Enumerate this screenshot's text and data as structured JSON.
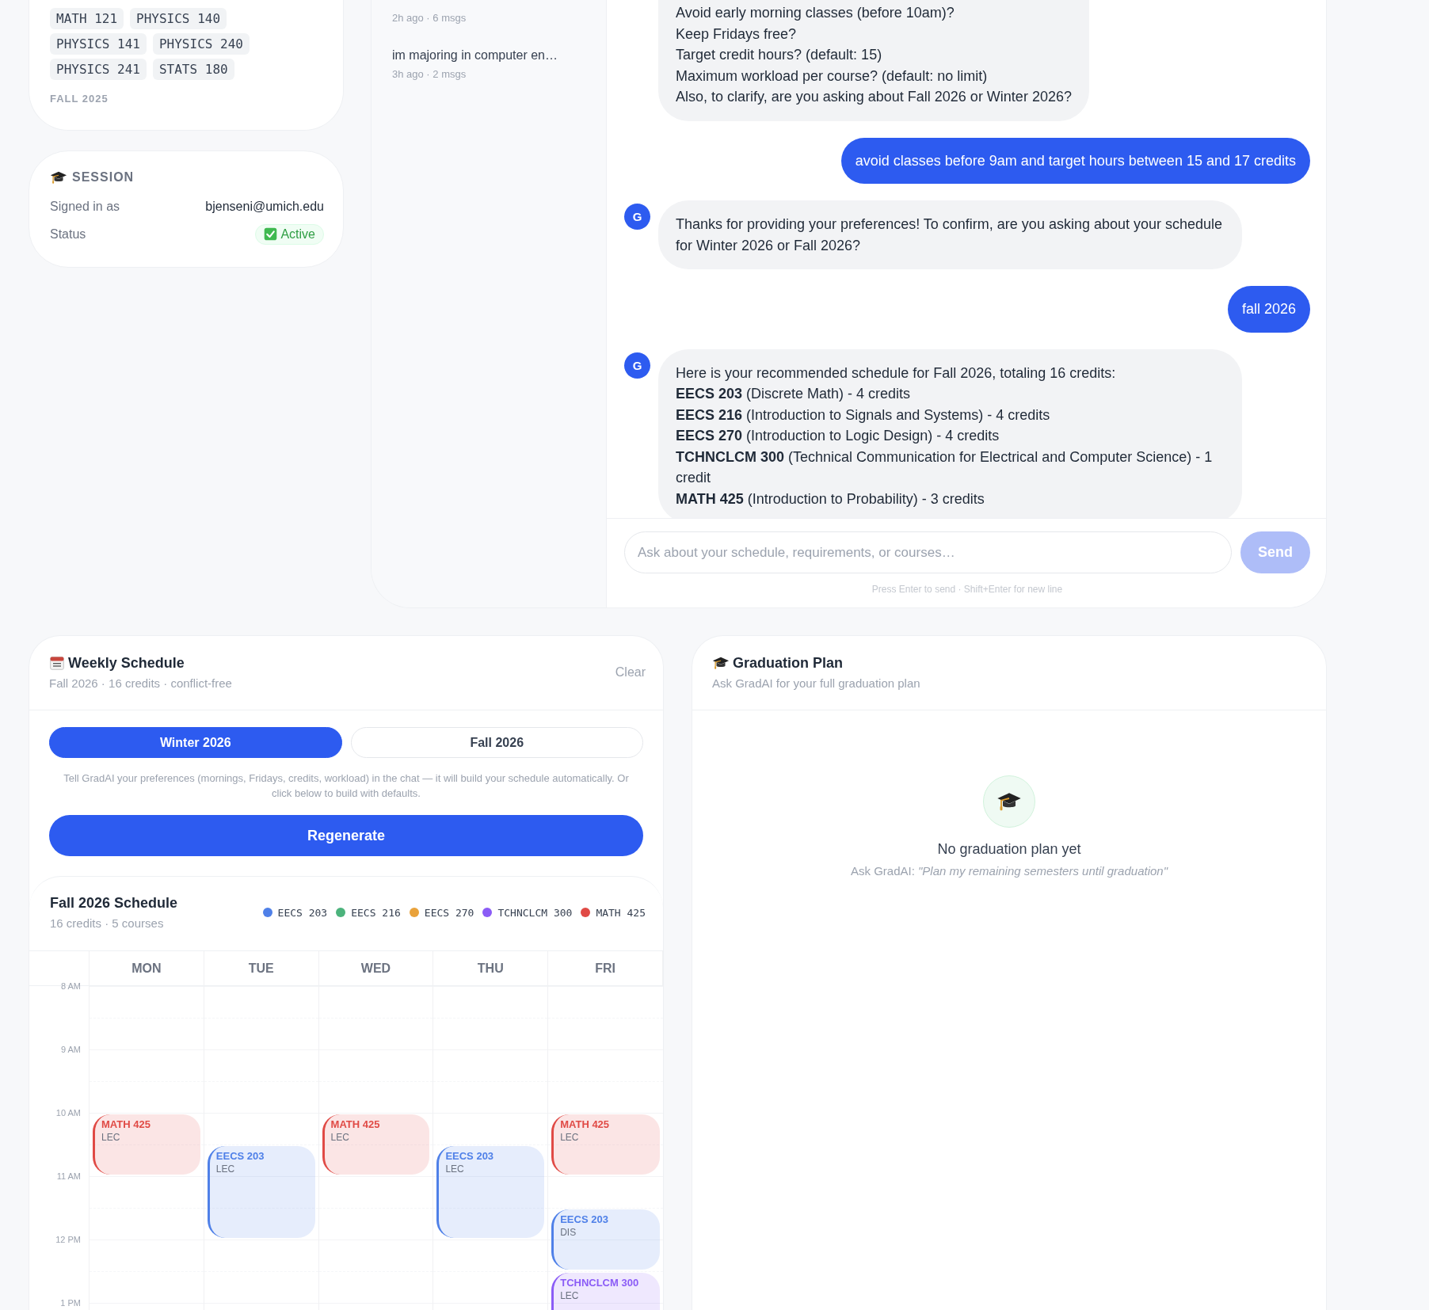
{
  "profile_card": {
    "course_tag_rows": [
      [
        "MATH 121",
        "PHYSICS 140"
      ],
      [
        "PHYSICS 141",
        "PHYSICS 240"
      ],
      [
        "PHYSICS 241",
        "STATS 180"
      ]
    ],
    "term_label": "FALL 2025"
  },
  "session": {
    "title": "SESSION",
    "rows": [
      {
        "label": "Signed in as",
        "value": "bjenseni@umich.edu",
        "kind": "text"
      },
      {
        "label": "Status",
        "value": "Active",
        "kind": "badge"
      }
    ]
  },
  "chat_history": [
    {
      "meta": "2h ago · 6 msgs"
    },
    {
      "title": "im majoring in computer en…",
      "meta": "3h ago · 2 msgs"
    }
  ],
  "chat": {
    "messages": [
      {
        "kind": "assistant",
        "lines": [
          "Avoid early morning classes (before 10am)?",
          "Keep Fridays free?",
          "Target credit hours? (default: 15)",
          "Maximum workload per course? (default: no limit)",
          "Also, to clarify, are you asking about Fall 2026 or Winter 2026?"
        ]
      },
      {
        "kind": "user",
        "lines": [
          "avoid classes before 9am and target hours between 15 and 17 credits"
        ]
      },
      {
        "kind": "assistant",
        "avatar": "G",
        "lines": [
          "Thanks for providing your preferences! To confirm, are you asking about your schedule for Winter 2026 or Fall 2026?"
        ]
      },
      {
        "kind": "user",
        "lines": [
          "fall 2026"
        ]
      },
      {
        "kind": "assistant",
        "avatar": "G",
        "lines": [
          "Here is your recommended schedule for Fall 2026, totaling 16 credits:",
          "**EECS 203** (Discrete Math) - 4 credits",
          "**EECS 216** (Introduction to Signals and Systems) - 4 credits",
          "**EECS 270** (Introduction to Logic Design) - 4 credits",
          "**TCHNCLCM 300** (Technical Communication for Electrical and Computer Science) - 1 credit",
          "**MATH 425** (Introduction to Probability) - 3 credits"
        ]
      }
    ],
    "input": {
      "placeholder": "Ask about your schedule, requirements, or courses…"
    },
    "send_button": {
      "label": "Send",
      "disabled": true
    },
    "hint": "Press Enter to send · Shift+Enter for new line"
  },
  "weekly_schedule": {
    "title": "Weekly Schedule",
    "subtitle": "Fall 2026 · 16 credits · conflict-free",
    "clear_label": "Clear",
    "term_tabs": [
      {
        "label": "Winter 2026",
        "selected": true
      },
      {
        "label": "Fall 2026",
        "selected": false
      }
    ],
    "hint": "Tell GradAI your preferences (mornings, Fridays, credits, workload) in the chat — it will build your schedule automatically. Or click below to build with defaults.",
    "regenerate_label": "Regenerate",
    "calendar": {
      "title": "Fall 2026 Schedule",
      "subtitle": "16 credits · 5 courses",
      "legend": [
        {
          "label": "EECS 203",
          "color": "#4f80e8"
        },
        {
          "label": "EECS 216",
          "color": "#4cb37c"
        },
        {
          "label": "EECS 270",
          "color": "#e9a23b"
        },
        {
          "label": "TCHNCLCM 300",
          "color": "#8b5cf6"
        },
        {
          "label": "MATH 425",
          "color": "#e04a45"
        }
      ],
      "hours": [
        "8 AM",
        "9 AM",
        "10 AM",
        "11 AM",
        "12 PM",
        "1 PM"
      ],
      "days": [
        {
          "label": "MON",
          "blocks": [
            {
              "kind": "free"
            },
            {
              "kind": "free"
            },
            {
              "kind": "free"
            },
            {
              "kind": "free"
            },
            {
              "kind": "hour_class",
              "course": "MATH 425",
              "type": "LEC",
              "color": "#e04a45"
            }
          ]
        },
        {
          "label": "TUE",
          "blocks": [
            {
              "kind": "free"
            },
            {
              "kind": "free"
            },
            {
              "kind": "free"
            },
            {
              "kind": "free"
            },
            {
              "kind": "free"
            },
            {
              "kind": "long_class",
              "course": "EECS 203",
              "type": "LEC",
              "color": "#4f80e8"
            }
          ]
        },
        {
          "label": "WED",
          "blocks": [
            {
              "kind": "free"
            },
            {
              "kind": "free"
            },
            {
              "kind": "free"
            },
            {
              "kind": "free"
            },
            {
              "kind": "hour_class",
              "course": "MATH 425",
              "type": "LEC",
              "color": "#e04a45"
            }
          ]
        },
        {
          "label": "THU",
          "blocks": [
            {
              "kind": "free"
            },
            {
              "kind": "free"
            },
            {
              "kind": "free"
            },
            {
              "kind": "free"
            },
            {
              "kind": "free"
            },
            {
              "kind": "long_class",
              "course": "EECS 203",
              "type": "LEC",
              "color": "#4f80e8"
            }
          ]
        },
        {
          "label": "FRI",
          "blocks": [
            {
              "kind": "free"
            },
            {
              "kind": "free"
            },
            {
              "kind": "free"
            },
            {
              "kind": "free"
            },
            {
              "kind": "hour_class",
              "course": "MATH 425",
              "type": "LEC",
              "color": "#e04a45"
            },
            {
              "kind": "free"
            },
            {
              "kind": "hour_class",
              "course": "EECS 203",
              "type": "DIS",
              "color": "#4f80e8"
            },
            {
              "kind": "hour_class",
              "course": "TCHNCLCM 300",
              "type": "LEC",
              "color": "#8b5cf6"
            }
          ]
        }
      ]
    }
  },
  "graduation_plan": {
    "title": "Graduation Plan",
    "subtitle": "Ask GradAI for your full graduation plan",
    "empty_title": "No graduation plan yet",
    "empty_hint": "Ask GradAI: *\"Plan my remaining semesters until graduation\"*"
  }
}
